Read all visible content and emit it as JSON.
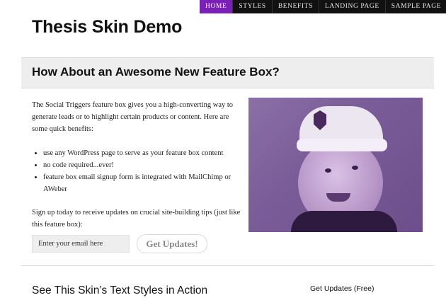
{
  "nav": {
    "items": [
      {
        "label": "Home",
        "active": true
      },
      {
        "label": "Styles",
        "active": false
      },
      {
        "label": "Benefits",
        "active": false
      },
      {
        "label": "Landing Page",
        "active": false
      },
      {
        "label": "Sample Page",
        "active": false
      }
    ],
    "active_color": "#7a1fb8"
  },
  "site": {
    "title": "Thesis Skin Demo"
  },
  "feature": {
    "heading": "How About an Awesome New Feature Box?",
    "intro": "The Social Triggers feature box gives you a high-converting way to generate leads or to highlight certain products or content. Here are some quick benefits:",
    "benefits": [
      "use any WordPress page to serve as your feature box content",
      "no code required...ever!",
      "feature box email signup form is integrated with MailChimp or AWeber"
    ],
    "cta_text": "Sign up today to receive updates on crucial site-building tips (just like this feature box):",
    "email_placeholder": "Enter your email here",
    "button_label": "Get Updates!"
  },
  "content": {
    "section_heading": "See This Skin’s Text Styles in Action"
  },
  "sidebar": {
    "heading": "Get Updates (Free)"
  }
}
